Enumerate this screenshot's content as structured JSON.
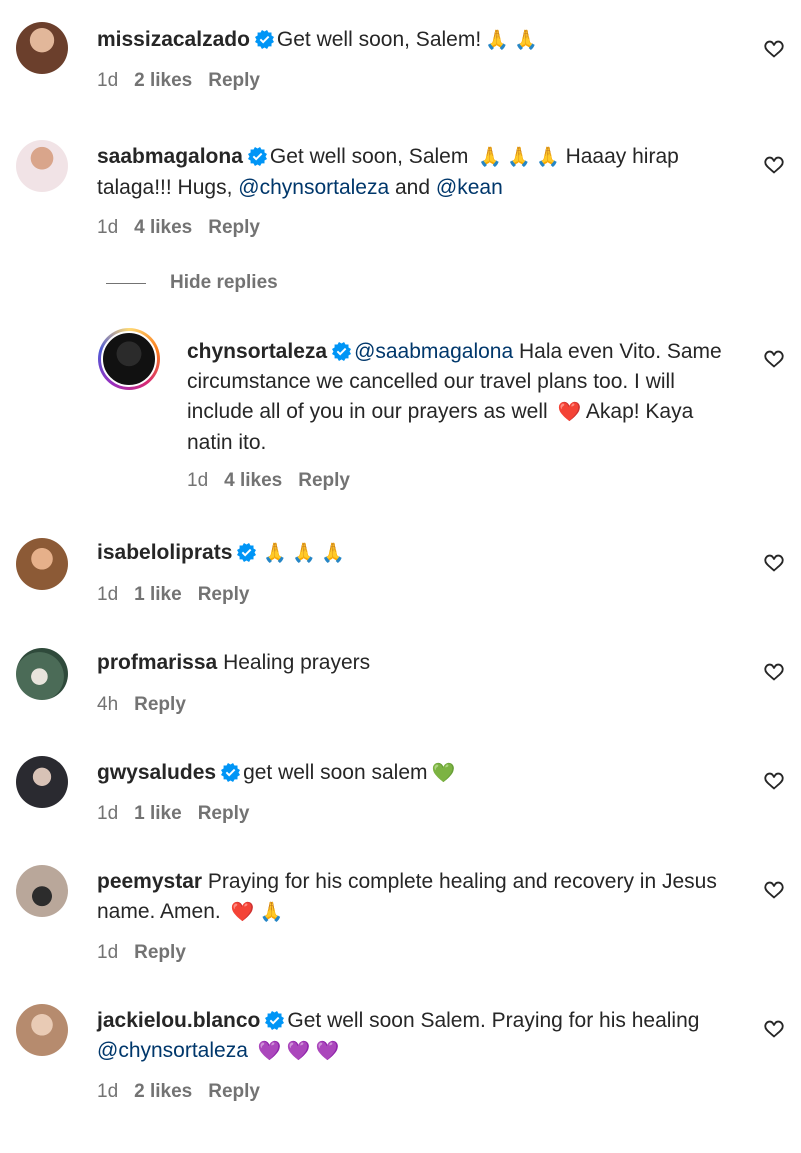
{
  "comments": [
    {
      "username": "missizacalzado",
      "verified": true,
      "text": "Get well soon, Salem!",
      "emojis": "🙏 🙏",
      "time": "1d",
      "likes": "2 likes",
      "reply": "Reply",
      "avatar_color": "#8a5a44"
    },
    {
      "username": "saabmagalona",
      "verified": true,
      "text_before": "Get well soon, Salem",
      "emojis": "🙏 🙏 🙏",
      "text_after": "Haaay hirap talaga!!! Hugs,",
      "mention1": "@chynsortaleza",
      "and": "and",
      "mention2": "@kean",
      "time": "1d",
      "likes": "4 likes",
      "reply": "Reply",
      "avatar_color": "#e8c9cf"
    },
    {
      "hide_replies": "Hide replies"
    },
    {
      "username": "chynsortaleza",
      "verified": true,
      "mention": "@saabmagalona",
      "text_before": "Hala even Vito. Same circumstance we cancelled our travel plans too. I will include all of you in our prayers as well",
      "emoji": "❤️",
      "text_after": "Akap! Kaya natin ito.",
      "time": "1d",
      "likes": "4 likes",
      "reply": "Reply"
    },
    {
      "username": "isabeloliprats",
      "verified": true,
      "emojis": "🙏 🙏 🙏",
      "time": "1d",
      "likes": "1 like",
      "reply": "Reply",
      "avatar_color": "#b07650"
    },
    {
      "username": "profmarissa",
      "verified": false,
      "text": "Healing prayers",
      "time": "4h",
      "reply": "Reply",
      "avatar_color": "#5e7f6a"
    },
    {
      "username": "gwysaludes",
      "verified": true,
      "text": "get well soon salem",
      "emojis": "💚",
      "time": "1d",
      "likes": "1 like",
      "reply": "Reply",
      "avatar_color": "#3a3a44"
    },
    {
      "username": "peemystar",
      "verified": false,
      "text": "Praying for his complete healing and recovery in Jesus name. Amen.",
      "emojis": "❤️ 🙏",
      "time": "1d",
      "reply": "Reply",
      "avatar_color": "#9a8a7a"
    },
    {
      "username": "jackielou.blanco",
      "verified": true,
      "text": "Get well soon Salem. Praying for his healing",
      "mention": "@chynsortaleza",
      "emojis": "💜 💜 💜",
      "time": "1d",
      "likes": "2 likes",
      "reply": "Reply",
      "avatar_color": "#c9a48a"
    }
  ],
  "colors": {
    "mention": "#00376b",
    "verified": "#0095f6",
    "meta": "#737373"
  }
}
